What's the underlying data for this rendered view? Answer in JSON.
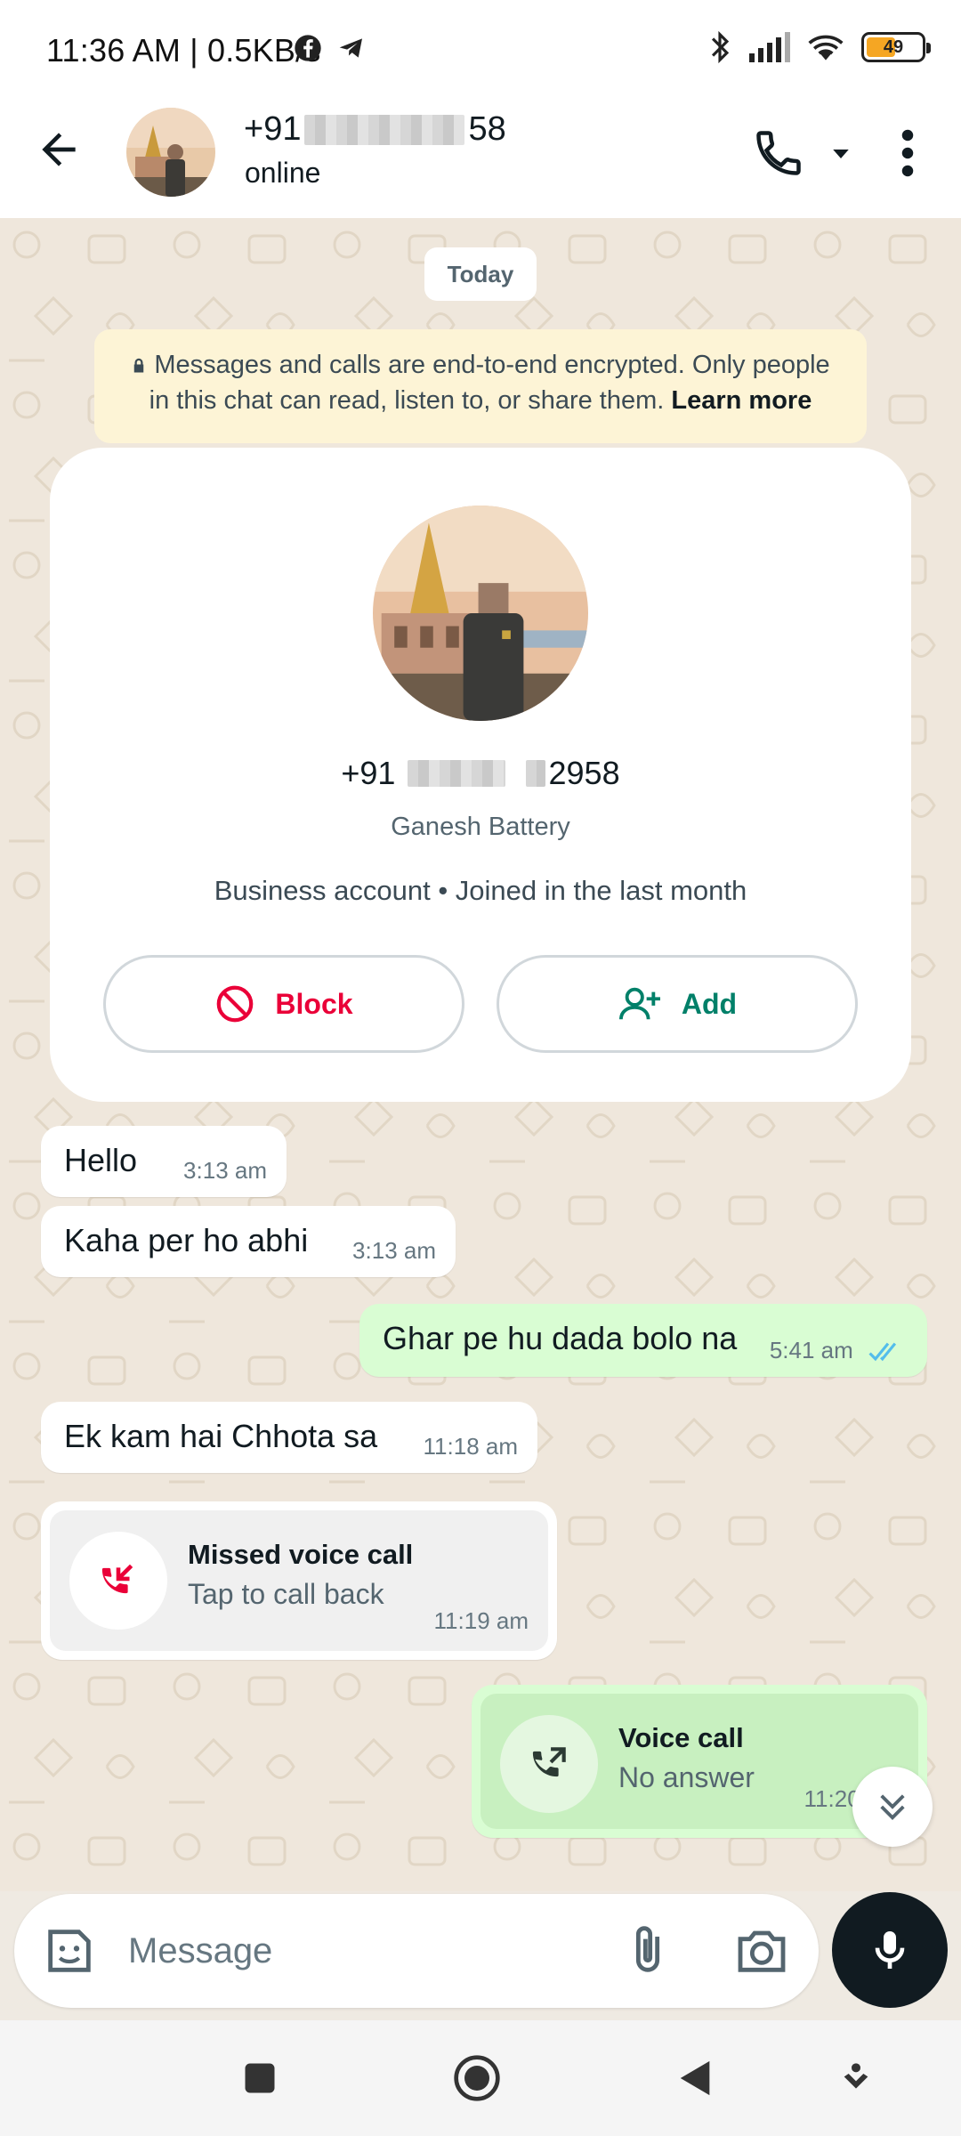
{
  "status_bar": {
    "time": "11:36 AM | 0.5KB/s",
    "battery": "49"
  },
  "header": {
    "name_prefix": "+91",
    "name_suffix": "58",
    "status": "online"
  },
  "chat": {
    "date_chip": "Today",
    "encryption": {
      "text": "Messages and calls are end-to-end encrypted. Only people in this chat can read, listen to, or share them.",
      "link": "Learn more"
    },
    "profile_card": {
      "phone_prefix": "+91",
      "phone_suffix": "2958",
      "business_name": "Ganesh Battery",
      "meta": "Business account • Joined in the last month",
      "block_label": "Block",
      "add_label": "Add"
    },
    "messages": [
      {
        "text": "Hello",
        "time": "3:13 am",
        "direction": "in"
      },
      {
        "text": "Kaha per ho abhi",
        "time": "3:13 am",
        "direction": "in"
      },
      {
        "text": "Ghar pe hu dada bolo na",
        "time": "5:41 am",
        "direction": "out"
      },
      {
        "text": "Ek kam hai Chhota sa",
        "time": "11:18 am",
        "direction": "in"
      }
    ],
    "missed_call": {
      "title": "Missed voice call",
      "subtitle": "Tap to call back",
      "time": "11:19 am"
    },
    "voice_call": {
      "title": "Voice call",
      "subtitle": "No answer",
      "time": "11:20 am"
    }
  },
  "input": {
    "placeholder": "Message"
  },
  "colors": {
    "accent_green": "#008069",
    "block_red": "#ea0038",
    "outgoing_bubble": "#d9fdd3",
    "read_ticks": "#53bdeb"
  }
}
